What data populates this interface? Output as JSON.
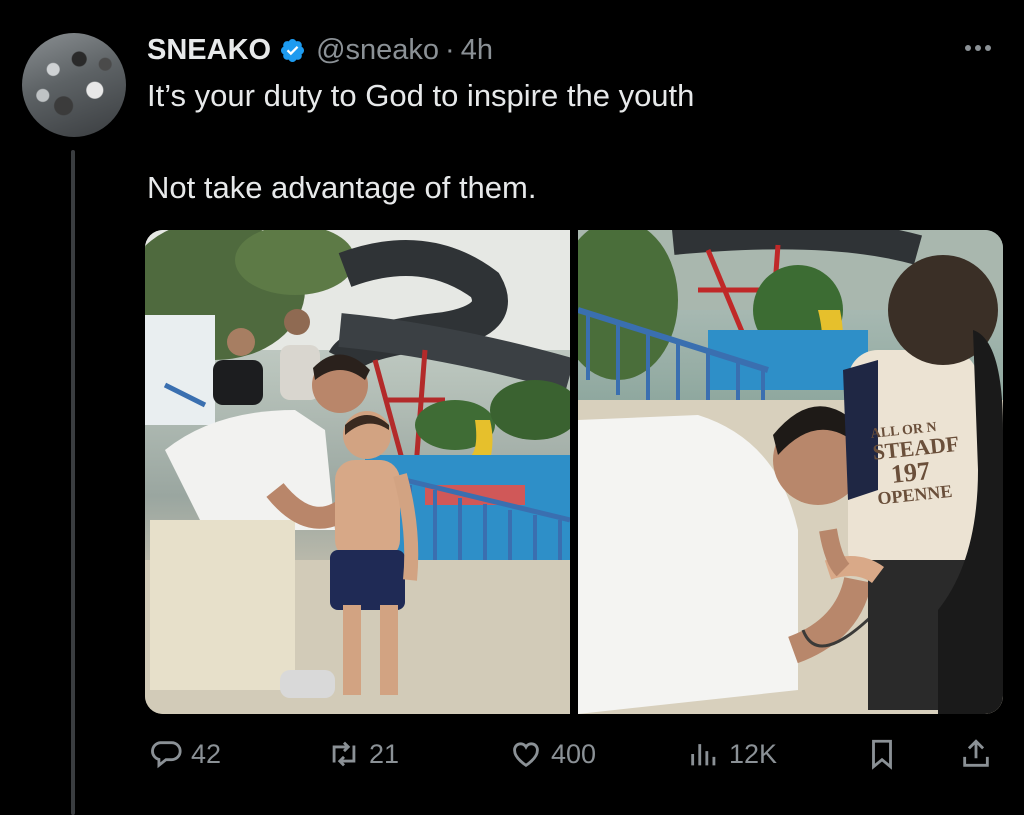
{
  "tweet": {
    "author_name": "SNEAKO",
    "handle": "@sneako",
    "separator": "·",
    "time": "4h",
    "text_line_1": "It’s your duty to God to inspire the youth",
    "text_line_2": "Not take advantage of them."
  },
  "media": {
    "shirt_text": [
      "ALL OR N",
      "STEADF",
      "197",
      "OPENNE"
    ]
  },
  "actions": {
    "replies": "42",
    "retweets": "21",
    "likes": "400",
    "views": "12K"
  },
  "colors": {
    "background": "#000000",
    "text_primary": "#e7e9ea",
    "text_secondary": "#8b9196",
    "verified_blue": "#1d9bf0"
  },
  "icons": {
    "verified": "verified-badge-icon",
    "more": "more-options-icon",
    "reply": "reply-icon",
    "retweet": "retweet-icon",
    "like": "heart-icon",
    "views": "views-icon",
    "bookmark": "bookmark-icon",
    "share": "share-icon"
  }
}
